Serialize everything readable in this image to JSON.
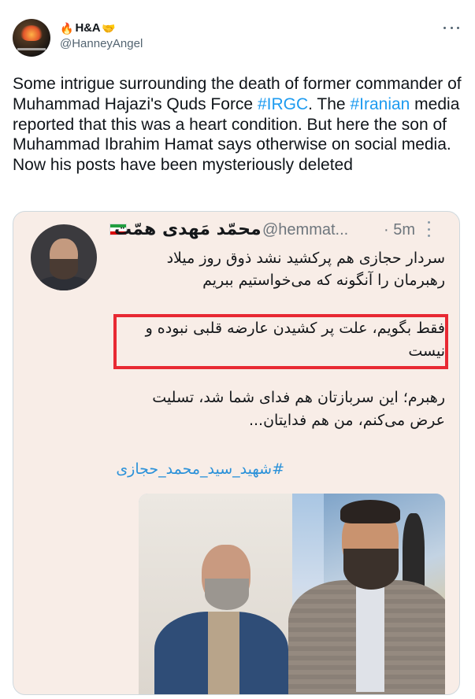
{
  "tweet": {
    "display_name": "H&A",
    "name_emoji_left": "🔥",
    "name_emoji_right": "🤝",
    "handle": "@HanneyAngel",
    "text_parts": [
      "Some intrigue surrounding the death of former commander of Muhammad Hajazi's Quds Force ",
      "#IRGC",
      ". The ",
      "#Iranian",
      " media reported that this was a heart condition.  But here the son of Muhammad Ibrahim Hamat says otherwise on social media.",
      "Now his posts have been mysteriously deleted"
    ]
  },
  "embedded": {
    "name": "محمّد مَهدی همّت",
    "handle": "@hemmat...",
    "time": "· 5m",
    "paragraph1": "سردار حجازی هم پرکشید نشد ذوق روز میلاد رهبرمان را آنگونه که می‌خواستیم ببریم",
    "paragraph2": "فقط بگویم، علت پر کشیدن عارضه قلبی نبوده و نیست",
    "paragraph3": "رهبرم؛ این سربازتان هم فدای شما شد، تسلیت عرض می‌کنم، من هم فدایتان...",
    "hashtag": "#شهید_سید_محمد_حجازی",
    "highlight_color": "#e82933",
    "flag_colors": [
      "#239f40",
      "#ffffff",
      "#da0000"
    ]
  },
  "colors": {
    "link": "#1d9bf0",
    "card_bg": "#f8ede7"
  }
}
